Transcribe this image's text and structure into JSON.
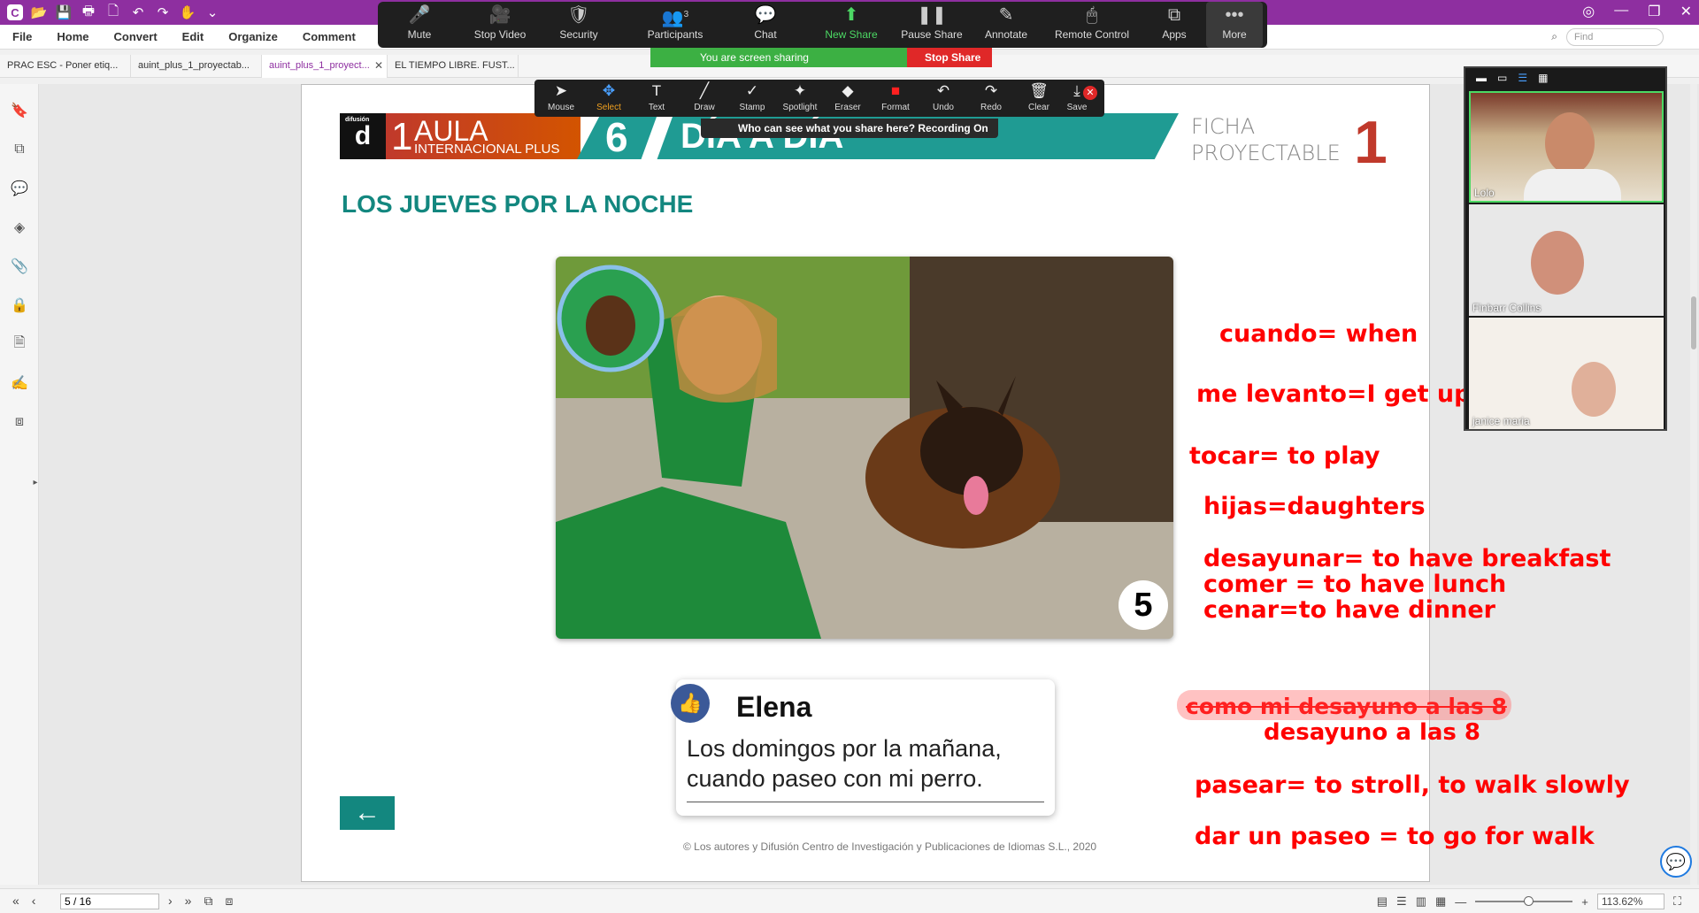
{
  "colors": {
    "titlebar": "#8e2fa0",
    "teal": "#13877f",
    "annotation_red": "#ff0000",
    "zoom_green": "#3cb043",
    "stop_red": "#e02828"
  },
  "menu": {
    "items": [
      "File",
      "Home",
      "Convert",
      "Edit",
      "Organize",
      "Comment"
    ],
    "find_placeholder": "Find"
  },
  "tabs": [
    "PRAC ESC - Poner etiq...",
    "auint_plus_1_proyectab...",
    "auint_plus_1_proyect...",
    "EL TIEMPO LIBRE. FUST..."
  ],
  "zoom_toolbar": {
    "items": [
      {
        "label": "Mute",
        "icon": "microphone-icon"
      },
      {
        "label": "Stop Video",
        "icon": "video-camera-icon"
      },
      {
        "label": "Security",
        "icon": "shield-icon"
      },
      {
        "label": "Participants",
        "icon": "participants-icon",
        "count": "3"
      },
      {
        "label": "Chat",
        "icon": "chat-icon"
      },
      {
        "label": "New Share",
        "icon": "share-arrow-icon"
      },
      {
        "label": "Pause Share",
        "icon": "pause-icon"
      },
      {
        "label": "Annotate",
        "icon": "pencil-icon"
      },
      {
        "label": "Remote Control",
        "icon": "mouse-icon"
      },
      {
        "label": "Apps",
        "icon": "apps-icon"
      },
      {
        "label": "More",
        "icon": "more-dots-icon"
      }
    ],
    "sharing_text": "You are screen sharing",
    "stop_share": "Stop Share"
  },
  "annotation_toolbar": {
    "items": [
      "Mouse",
      "Select",
      "Text",
      "Draw",
      "Stamp",
      "Spotlight",
      "Eraser",
      "Format",
      "Undo",
      "Redo",
      "Clear",
      "Save"
    ],
    "recording_text": "Who can see what you share here? Recording On"
  },
  "video_panel": {
    "participants": [
      {
        "name": "Lolo"
      },
      {
        "name": "Finbarr Collins"
      },
      {
        "name": "janice maria"
      }
    ]
  },
  "document": {
    "publisher": "difusión",
    "level": "1",
    "series_aula": "AULA",
    "series_intl": "INTERNACIONAL PLUS",
    "unit_number": "6",
    "unit_title": "DÍA A DÍA",
    "ficha_line1": "FICHA",
    "ficha_line2": "PROYECTABLE",
    "ficha_number": "1",
    "section_title": "LOS JUEVES POR LA NOCHE",
    "photo_number": "5",
    "card_name": "Elena",
    "card_line1": "Los domingos por la mañana,",
    "card_line2": "cuando paseo con mi perro.",
    "back_arrow": "←",
    "copyright": "© Los autores y Difusión Centro de Investigación y Publicaciones de Idiomas S.L., 2020"
  },
  "annotations": [
    "cuando= when",
    "me levanto=I get up",
    "tocar= to play",
    "hijas=daughters",
    "desayunar= to have breakfast",
    "comer = to have lunch",
    "cenar=to have dinner",
    "como mi desayuno a las 8",
    "desayuno a las 8",
    "pasear= to stroll, to walk slowly",
    "dar un paseo = to go for walk"
  ],
  "statusbar": {
    "page_field": "5 / 16",
    "zoom": "113.62%"
  }
}
